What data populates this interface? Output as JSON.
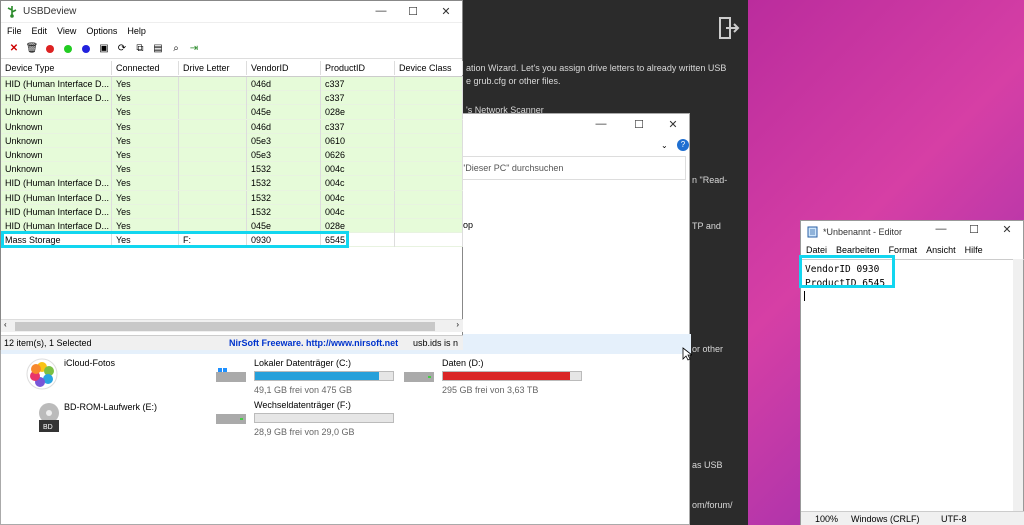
{
  "background_text": {
    "wizard": "ation Wizard. Let's you assign drive letters to already written USB",
    "grub": "e grub.cfg or other files.",
    "scanner": "'s Network Scanner",
    "read": "n \"Read-",
    "tp_and": "TP and",
    "or_other": "or other",
    "as_usb": "as USB",
    "forum": "om/forum/"
  },
  "explorer": {
    "search_placeholder": "\"Dieser PC\" durchsuchen",
    "fragment_op": "op",
    "drives": [
      {
        "name": "iCloud-Fotos"
      },
      {
        "name": "BD-ROM-Laufwerk (E:)"
      },
      {
        "name": "Lokaler Datenträger (C:)",
        "info": "49,1 GB frei von 475 GB",
        "used_fraction": 0.9
      },
      {
        "name": "Wechseldatenträger (F:)",
        "info": "28,9 GB frei von 29,0 GB",
        "used_fraction": 0.0
      },
      {
        "name": "Daten (D:)",
        "info": "295 GB frei von 3,63 TB",
        "used_fraction": 0.92
      }
    ],
    "colors": {
      "normal_bar": "#26a0da",
      "full_bar": "#da2626"
    }
  },
  "usbdeview": {
    "title": "USBDeview",
    "menu": [
      "File",
      "Edit",
      "View",
      "Options",
      "Help"
    ],
    "columns": [
      "Device Type",
      "Connected",
      "Drive Letter",
      "VendorID",
      "ProductID",
      "Device Class"
    ],
    "rows": [
      [
        "HID (Human Interface D...",
        "Yes",
        "",
        "046d",
        "c337",
        ""
      ],
      [
        "HID (Human Interface D...",
        "Yes",
        "",
        "046d",
        "c337",
        ""
      ],
      [
        "Unknown",
        "Yes",
        "",
        "045e",
        "028e",
        ""
      ],
      [
        "Unknown",
        "Yes",
        "",
        "046d",
        "c337",
        ""
      ],
      [
        "Unknown",
        "Yes",
        "",
        "05e3",
        "0610",
        ""
      ],
      [
        "Unknown",
        "Yes",
        "",
        "05e3",
        "0626",
        ""
      ],
      [
        "Unknown",
        "Yes",
        "",
        "1532",
        "004c",
        ""
      ],
      [
        "HID (Human Interface D...",
        "Yes",
        "",
        "1532",
        "004c",
        ""
      ],
      [
        "HID (Human Interface D...",
        "Yes",
        "",
        "1532",
        "004c",
        ""
      ],
      [
        "HID (Human Interface D...",
        "Yes",
        "",
        "1532",
        "004c",
        ""
      ],
      [
        "HID (Human Interface D...",
        "Yes",
        "",
        "045e",
        "028e",
        ""
      ],
      [
        "Mass Storage",
        "Yes",
        "F:",
        "0930",
        "6545",
        ""
      ]
    ],
    "status": {
      "count": "12 item(s), 1 Selected",
      "nirsoft": "NirSoft Freeware.  http://www.nirsoft.net",
      "usbids": "usb.ids is n"
    },
    "colors": {
      "row_green": "#e6fbd9",
      "highlight": "#12d6f0"
    }
  },
  "notepad": {
    "title": "*Unbenannt - Editor",
    "menu": [
      "Datei",
      "Bearbeiten",
      "Format",
      "Ansicht",
      "Hilfe"
    ],
    "lines": [
      "VendorID 0930",
      "ProductID 6545"
    ],
    "status": {
      "zoom": "100%",
      "eol": "Windows (CRLF)",
      "enc": "UTF-8"
    }
  }
}
